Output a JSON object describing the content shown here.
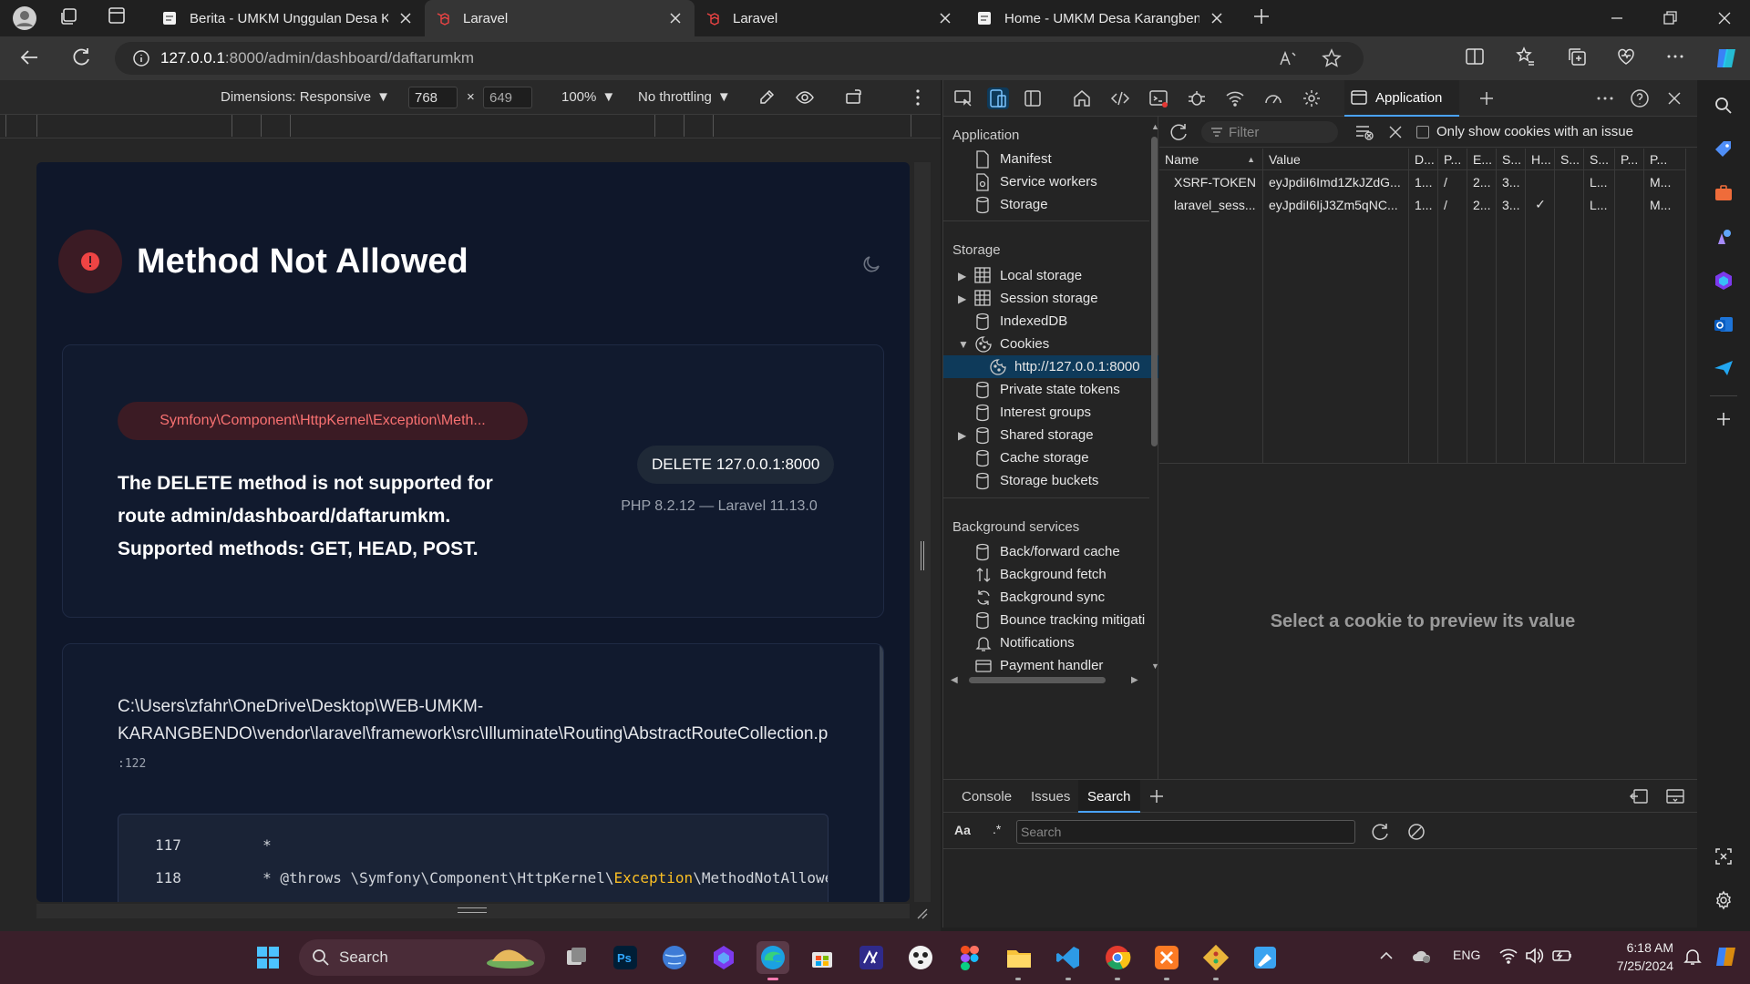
{
  "tabs": [
    {
      "title": "Berita - UMKM Unggulan Desa K",
      "active": false
    },
    {
      "title": "Laravel",
      "active": true
    },
    {
      "title": "Laravel",
      "active": false
    },
    {
      "title": "Home - UMKM Desa Karangbenc",
      "active": false
    }
  ],
  "address": {
    "host": "127.0.0.1",
    "path": ":8000/admin/dashboard/daftarumkm"
  },
  "device_toolbar": {
    "dimensions_label": "Dimensions: Responsive",
    "width": "768",
    "times": "×",
    "height": "649",
    "zoom": "100%",
    "throttling": "No throttling"
  },
  "error_page": {
    "title": "Method Not Allowed",
    "exception_class": "Symfony\\Component\\HttpKernel\\Exception\\Meth...",
    "message_lines": [
      "The DELETE method is not supported for",
      "route admin/dashboard/daftarumkm.",
      "Supported methods: GET, HEAD, POST."
    ],
    "request": "DELETE 127.0.0.1:8000",
    "versions": "PHP 8.2.12 — Laravel 11.13.0",
    "file_path_line1": "C:\\Users\\zfahr\\OneDrive\\Desktop\\WEB-UMKM-",
    "file_path_line2": "KARANGBENDO\\vendor\\laravel\\framework\\src\\Illuminate\\Routing\\AbstractRouteCollection.p",
    "line_ref": ":122",
    "code": [
      {
        "num": "117",
        "pre": "     *",
        "hl": "",
        "post": ""
      },
      {
        "num": "118",
        "pre": "     * @throws \\Symfony\\Component\\HttpKernel\\",
        "hl": "Exception",
        "post": "\\MethodNotAllowed"
      }
    ]
  },
  "devtools": {
    "active_tab": "Application",
    "sidebar": {
      "application_header": "Application",
      "application_items": [
        "Manifest",
        "Service workers",
        "Storage"
      ],
      "storage_header": "Storage",
      "storage_items": [
        "Local storage",
        "Session storage",
        "IndexedDB",
        "Cookies",
        "http://127.0.0.1:8000",
        "Private state tokens",
        "Interest groups",
        "Shared storage",
        "Cache storage",
        "Storage buckets"
      ],
      "background_header": "Background services",
      "background_items": [
        "Back/forward cache",
        "Background fetch",
        "Background sync",
        "Bounce tracking mitigati",
        "Notifications",
        "Payment handler"
      ]
    },
    "filter_placeholder": "Filter",
    "only_issues_label": "Only show cookies with an issue",
    "columns": [
      "Name",
      "Value",
      "D...",
      "P...",
      "E...",
      "S...",
      "H...",
      "S...",
      "S...",
      "P...",
      "P..."
    ],
    "rows": [
      [
        "XSRF-TOKEN",
        "eyJpdiI6Imd1ZkJZdG...",
        "1...",
        "/",
        "2...",
        "3...",
        "",
        "",
        "L...",
        "",
        "M..."
      ],
      [
        "laravel_sess...",
        "eyJpdiI6IjJ3Zm5qNC...",
        "1...",
        "/",
        "2...",
        "3...",
        "✓",
        "",
        "L...",
        "",
        "M..."
      ]
    ],
    "preview_text": "Select a cookie to preview its value",
    "drawer_tabs": [
      "Console",
      "Issues",
      "Search"
    ],
    "drawer_active": "Search",
    "search_aa": "Aa",
    "search_regex": ".*",
    "search_placeholder": "Search"
  },
  "taskbar": {
    "search_label": "Search",
    "lang": "ENG",
    "time": "6:18 AM",
    "date": "7/25/2024"
  }
}
